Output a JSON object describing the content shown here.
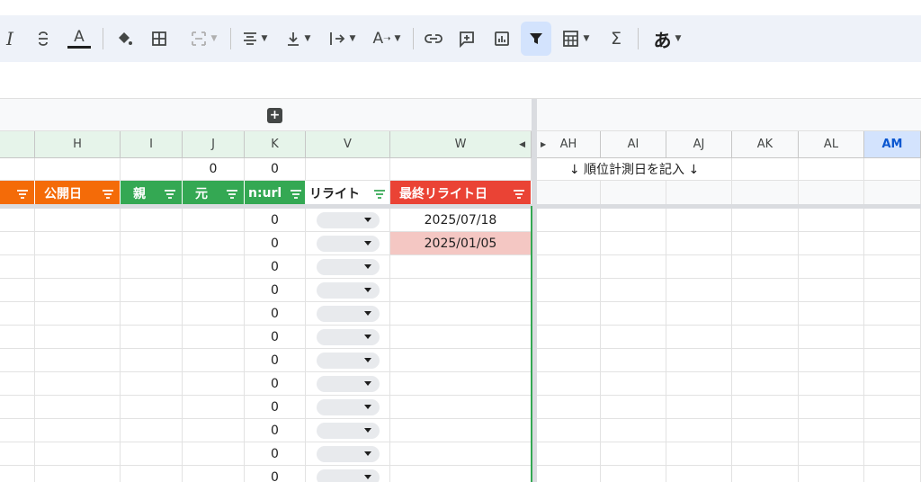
{
  "toolbar": {
    "italic": "I",
    "text_color_letter": "A",
    "font_color_letter": "A",
    "sigma": "Σ",
    "input_mode": "あ"
  },
  "columns_left": [
    "H",
    "I",
    "J",
    "K",
    "V",
    "W"
  ],
  "columns_right": [
    "AH",
    "AI",
    "AJ",
    "AK",
    "AL",
    "AM"
  ],
  "summary_row": {
    "J": "0",
    "K": "0",
    "note": "↓ 順位計測日を記入 ↓"
  },
  "header_row": {
    "koukai": "公開日",
    "oya": "親",
    "moto": "元",
    "nurl": "n:url",
    "rewrite": "リライト",
    "last_rewrite": "最終リライト日"
  },
  "rows": [
    {
      "k": "0",
      "w": "2025/07/18"
    },
    {
      "k": "0",
      "w": "2025/01/05"
    },
    {
      "k": "0",
      "w": ""
    },
    {
      "k": "0",
      "w": ""
    },
    {
      "k": "0",
      "w": ""
    },
    {
      "k": "0",
      "w": ""
    },
    {
      "k": "0",
      "w": ""
    },
    {
      "k": "0",
      "w": ""
    },
    {
      "k": "0",
      "w": ""
    },
    {
      "k": "0",
      "w": ""
    },
    {
      "k": "0",
      "w": ""
    },
    {
      "k": "0",
      "w": ""
    }
  ],
  "colors": {
    "orange": "#f46b08",
    "green": "#34a853",
    "red": "#ea4335",
    "pink_highlight": "#f4c7c3",
    "selected_col": "#d3e3fd"
  }
}
